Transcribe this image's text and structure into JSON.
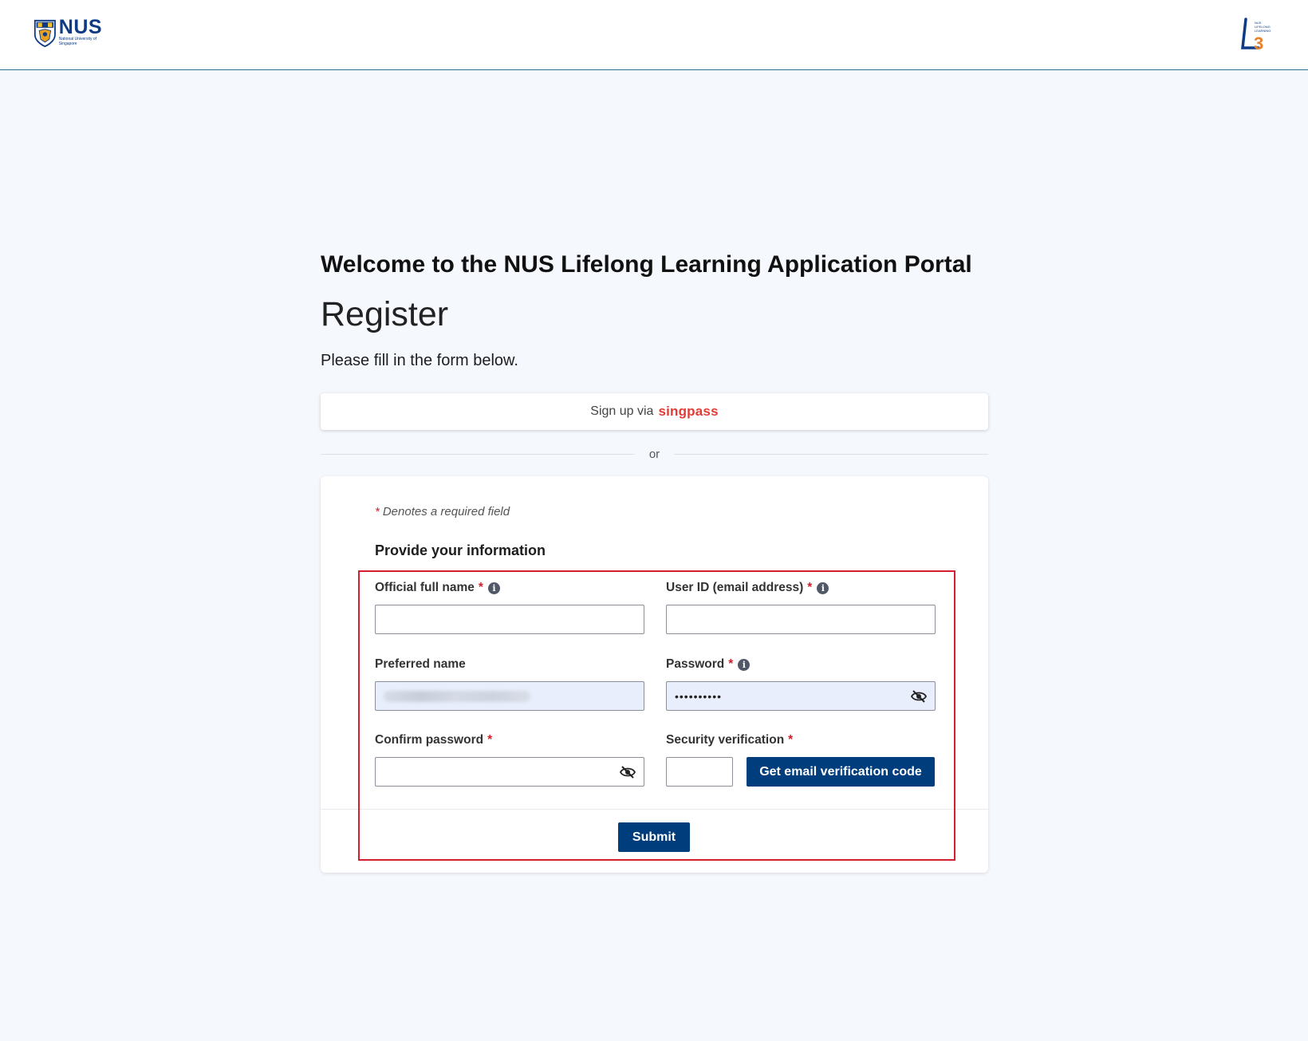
{
  "header": {
    "nus_logo_text": "NUS",
    "nus_logo_subtext": "National University of Singapore",
    "l3_logo_text": "LIFELONG LEARNING"
  },
  "page": {
    "welcome": "Welcome to the NUS Lifelong Learning Application Portal",
    "title": "Register",
    "intro": "Please fill in the form below."
  },
  "singpass": {
    "prefix": "Sign up via",
    "brand": "singpass"
  },
  "divider_text": "or",
  "form": {
    "required_star": "*",
    "required_note": "Denotes a required field",
    "section_title": "Provide your information",
    "fields": {
      "full_name": {
        "label": "Official full name",
        "required": "*",
        "value": ""
      },
      "user_id": {
        "label": "User ID (email address)",
        "required": "*",
        "value": ""
      },
      "preferred_name": {
        "label": "Preferred name",
        "value": ""
      },
      "password": {
        "label": "Password",
        "required": "*",
        "value": "••••••••••"
      },
      "confirm_password": {
        "label": "Confirm password",
        "required": "*",
        "value": ""
      },
      "security": {
        "label": "Security verification",
        "required": "*",
        "value": ""
      }
    },
    "get_code_label": "Get email verification code",
    "submit_label": "Submit"
  },
  "colors": {
    "primary": "#003d7c",
    "required": "#d0202b",
    "singpass": "#e23b35",
    "highlight": "#d41f2c",
    "page_bg": "#f5f8fd"
  },
  "icons": [
    "nus-crest-icon",
    "l3-logo-icon",
    "info-icon",
    "eye-slash-icon"
  ]
}
